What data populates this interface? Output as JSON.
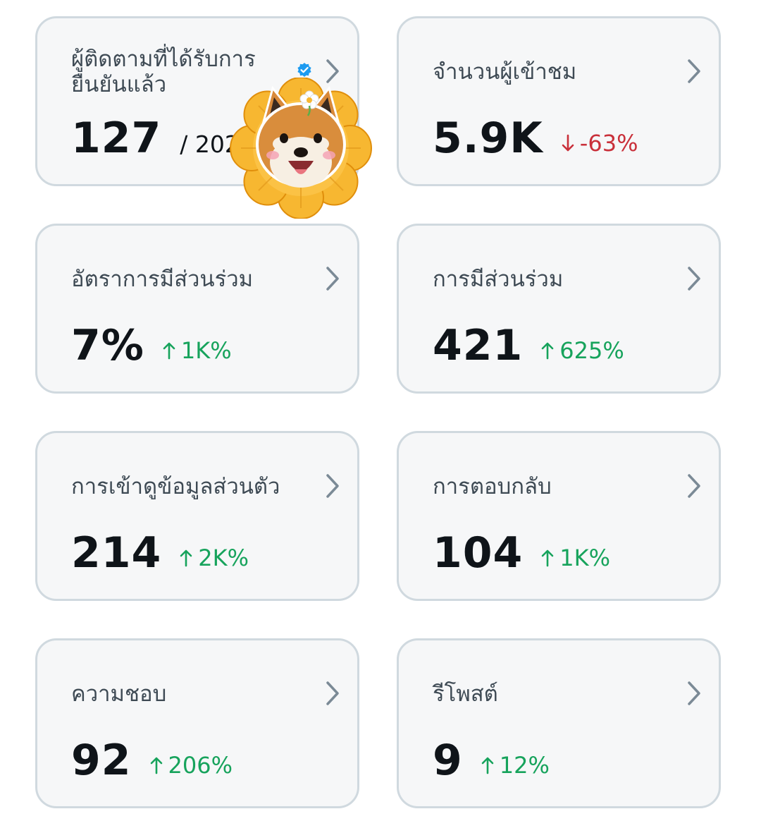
{
  "colors": {
    "card_bg": "#f6f7f8",
    "card_border": "#d0d9df",
    "up": "#17a35c",
    "down": "#c9303a",
    "verified": "#1d9bf0"
  },
  "cards": [
    {
      "label": "ผู้ติดตามที่ได้รับการยืนยันแล้ว",
      "value": "127",
      "total": "/ 202",
      "verified_icon": "verified-badge-icon"
    },
    {
      "label": "จำนวนผู้เข้าชม",
      "value": "5.9K",
      "change": "-63%",
      "direction": "down"
    },
    {
      "label": "อัตราการมีส่วนร่วม",
      "value": "7%",
      "change": "1K%",
      "direction": "up"
    },
    {
      "label": "การมีส่วนร่วม",
      "value": "421",
      "change": "625%",
      "direction": "up"
    },
    {
      "label": "การเข้าดูข้อมูลส่วนตัว",
      "value": "214",
      "change": "2K%",
      "direction": "up"
    },
    {
      "label": "การตอบกลับ",
      "value": "104",
      "change": "1K%",
      "direction": "up"
    },
    {
      "label": "ความชอบ",
      "value": "92",
      "change": "206%",
      "direction": "up"
    },
    {
      "label": "รีโพสต์",
      "value": "9",
      "change": "12%",
      "direction": "up"
    }
  ],
  "sticker": "shiba-dog-flower-sticker"
}
